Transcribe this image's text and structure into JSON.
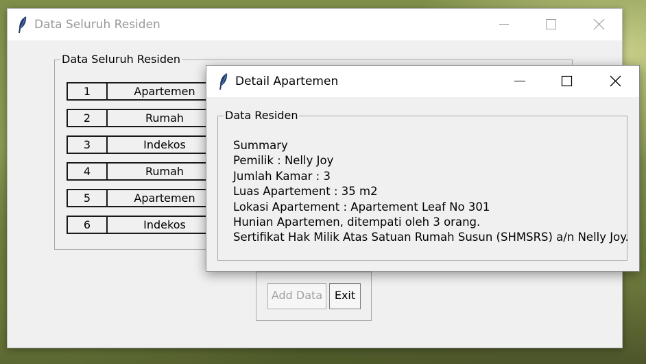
{
  "main_window": {
    "title": "Data Seluruh Residen",
    "frame_label": "Data Seluruh Residen",
    "rows": [
      {
        "no": "1",
        "type": "Apartemen"
      },
      {
        "no": "2",
        "type": "Rumah"
      },
      {
        "no": "3",
        "type": "Indekos"
      },
      {
        "no": "4",
        "type": "Rumah"
      },
      {
        "no": "5",
        "type": "Apartemen"
      },
      {
        "no": "6",
        "type": "Indekos"
      }
    ],
    "add_data_label": "Add Data",
    "exit_label": "Exit"
  },
  "detail_window": {
    "title": "Detail Apartemen",
    "frame_label": "Data Residen",
    "lines": [
      "Summary",
      "Pemilik : Nelly Joy",
      "Jumlah Kamar : 3",
      "Luas Apartement : 35 m2",
      "Lokasi Apartement : Apartement Leaf No 301",
      "Hunian Apartemen, ditempati oleh 3 orang.",
      "Sertifikat Hak Milik Atas Satuan Rumah Susun (SHMSRS) a/n Nelly Joy."
    ]
  },
  "colors": {
    "inactive_title": "#999999",
    "window_bg": "#f0f0f0",
    "titlebar_bg": "#ffffff",
    "disabled_text": "#a0a0a0",
    "feather": "#1f3b6b"
  },
  "icons": {
    "app": "feather-icon",
    "minimize": "minimize-icon",
    "maximize": "maximize-icon",
    "close": "close-icon"
  }
}
